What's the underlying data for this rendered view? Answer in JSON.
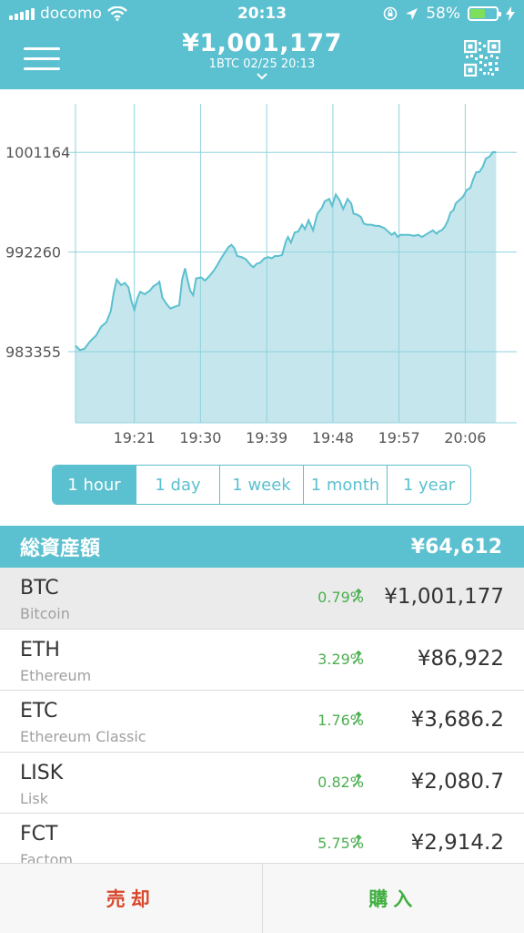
{
  "status_bar": {
    "carrier": "docomo",
    "time": "20:13",
    "battery": "58%",
    "battery_level": 0.58
  },
  "header": {
    "price": "¥1,001,177",
    "subtitle": "1BTC  02/25 20:13",
    "dropdown_icon": "chevron-down-icon",
    "menu_icon": "hamburger-menu-icon",
    "qr_icon": "qr-code-icon"
  },
  "chart_data": {
    "type": "area",
    "x_ticks": [
      "19:21",
      "19:30",
      "19:39",
      "19:48",
      "19:57",
      "20:06"
    ],
    "y_ticks": [
      1001164,
      992260,
      983355
    ],
    "ylim": [
      977000,
      1005500
    ],
    "x_range_minutes": [
      0,
      60
    ],
    "x_tick_minutes": [
      8,
      17,
      26,
      35,
      44,
      53
    ],
    "grid": true,
    "line_color": "#5bc0cf",
    "fill_color": "#c5e6ed",
    "points": [
      [
        0,
        983900
      ],
      [
        0.6,
        983500
      ],
      [
        1.2,
        983600
      ],
      [
        2,
        984300
      ],
      [
        2.8,
        984800
      ],
      [
        3.5,
        985600
      ],
      [
        4.2,
        986000
      ],
      [
        4.8,
        987000
      ],
      [
        5.2,
        988600
      ],
      [
        5.6,
        989800
      ],
      [
        6.2,
        989300
      ],
      [
        6.7,
        989500
      ],
      [
        7.2,
        989100
      ],
      [
        7.6,
        987900
      ],
      [
        8,
        987100
      ],
      [
        8.4,
        988100
      ],
      [
        8.8,
        988700
      ],
      [
        9.4,
        988500
      ],
      [
        10.1,
        988800
      ],
      [
        10.6,
        989200
      ],
      [
        11.1,
        989400
      ],
      [
        11.4,
        989600
      ],
      [
        11.8,
        988200
      ],
      [
        12.4,
        987600
      ],
      [
        12.9,
        987200
      ],
      [
        13.6,
        987400
      ],
      [
        14.1,
        987500
      ],
      [
        14.5,
        989800
      ],
      [
        14.9,
        990800
      ],
      [
        15.3,
        989600
      ],
      [
        15.6,
        988800
      ],
      [
        16,
        988400
      ],
      [
        16.4,
        989900
      ],
      [
        17.1,
        990000
      ],
      [
        17.6,
        989700
      ],
      [
        18.2,
        990100
      ],
      [
        18.8,
        990600
      ],
      [
        19.3,
        991100
      ],
      [
        19.8,
        991700
      ],
      [
        20.3,
        992200
      ],
      [
        20.8,
        992700
      ],
      [
        21.2,
        992900
      ],
      [
        21.6,
        992600
      ],
      [
        22,
        991900
      ],
      [
        22.6,
        991800
      ],
      [
        23.2,
        991600
      ],
      [
        23.8,
        991100
      ],
      [
        24.2,
        990900
      ],
      [
        24.6,
        991200
      ],
      [
        25.1,
        991300
      ],
      [
        25.7,
        991700
      ],
      [
        26.2,
        991800
      ],
      [
        26.7,
        991700
      ],
      [
        27.1,
        991900
      ],
      [
        27.6,
        991900
      ],
      [
        28.1,
        992000
      ],
      [
        28.6,
        993200
      ],
      [
        28.9,
        993600
      ],
      [
        29.3,
        993100
      ],
      [
        29.8,
        994000
      ],
      [
        30.3,
        994100
      ],
      [
        30.8,
        994700
      ],
      [
        31.2,
        994300
      ],
      [
        31.7,
        995100
      ],
      [
        32.3,
        994200
      ],
      [
        32.9,
        995700
      ],
      [
        33.5,
        996200
      ],
      [
        33.9,
        996800
      ],
      [
        34.5,
        997000
      ],
      [
        34.9,
        996400
      ],
      [
        35.4,
        997400
      ],
      [
        35.9,
        996900
      ],
      [
        36.4,
        996100
      ],
      [
        37,
        997000
      ],
      [
        37.5,
        996600
      ],
      [
        37.8,
        995700
      ],
      [
        38.3,
        995600
      ],
      [
        38.8,
        995400
      ],
      [
        39.2,
        994800
      ],
      [
        39.7,
        994700
      ],
      [
        40.2,
        994700
      ],
      [
        40.8,
        994600
      ],
      [
        41.3,
        994600
      ],
      [
        42,
        994400
      ],
      [
        42.5,
        994100
      ],
      [
        43,
        993800
      ],
      [
        43.4,
        994000
      ],
      [
        43.8,
        993600
      ],
      [
        44.2,
        993800
      ],
      [
        44.8,
        993800
      ],
      [
        45.4,
        993800
      ],
      [
        46,
        993700
      ],
      [
        46.6,
        993800
      ],
      [
        47.1,
        993600
      ],
      [
        47.6,
        993800
      ],
      [
        48.1,
        994000
      ],
      [
        48.6,
        994200
      ],
      [
        49.1,
        993900
      ],
      [
        49.4,
        994100
      ],
      [
        49.8,
        994200
      ],
      [
        50.2,
        994500
      ],
      [
        50.6,
        995000
      ],
      [
        51,
        995800
      ],
      [
        51.4,
        996000
      ],
      [
        51.7,
        996600
      ],
      [
        52.2,
        996900
      ],
      [
        52.7,
        997200
      ],
      [
        53.2,
        997800
      ],
      [
        53.7,
        998000
      ],
      [
        54.1,
        998800
      ],
      [
        54.5,
        999400
      ],
      [
        54.9,
        999400
      ],
      [
        55.4,
        999900
      ],
      [
        55.8,
        1000600
      ],
      [
        56.3,
        1000800
      ],
      [
        56.8,
        1001200
      ],
      [
        57.2,
        1001164
      ]
    ]
  },
  "range_tabs": {
    "items": [
      "1 hour",
      "1 day",
      "1 week",
      "1 month",
      "1 year"
    ],
    "active": "1 hour"
  },
  "total": {
    "label": "総資産額",
    "value": "¥64,612"
  },
  "assets": [
    {
      "symbol": "BTC",
      "name": "Bitcoin",
      "change": "0.79%",
      "value": "¥1,001,177",
      "trend_icon": "trend-up-arrow-icon"
    },
    {
      "symbol": "ETH",
      "name": "Ethereum",
      "change": "3.29%",
      "value": "¥86,922",
      "trend_icon": "trend-up-arrow-icon"
    },
    {
      "symbol": "ETC",
      "name": "Ethereum Classic",
      "change": "1.76%",
      "value": "¥3,686.2",
      "trend_icon": "trend-up-arrow-icon"
    },
    {
      "symbol": "LISK",
      "name": "Lisk",
      "change": "0.82%",
      "value": "¥2,080.7",
      "trend_icon": "trend-up-arrow-icon"
    },
    {
      "symbol": "FCT",
      "name": "Factom",
      "change": "5.75%",
      "value": "¥2,914.2",
      "trend_icon": "trend-up-arrow-icon"
    }
  ],
  "actions": {
    "sell": "売却",
    "buy": "購入"
  }
}
